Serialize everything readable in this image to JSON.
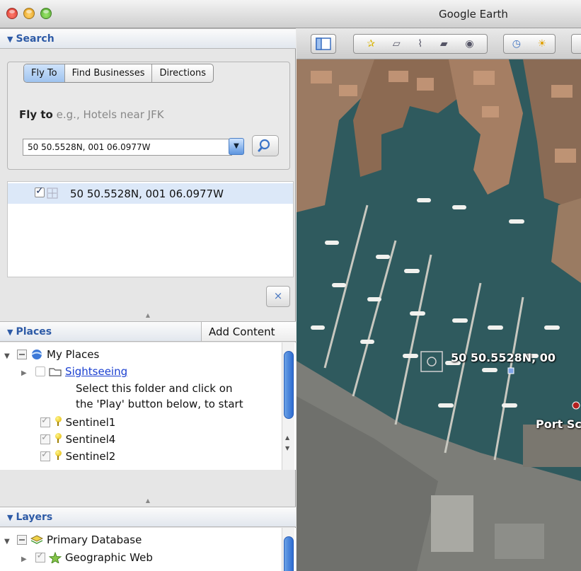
{
  "window": {
    "title": "Google Earth"
  },
  "search": {
    "header": "Search",
    "tabs": [
      {
        "label": "Fly To",
        "active": true
      },
      {
        "label": "Find Businesses",
        "active": false
      },
      {
        "label": "Directions",
        "active": false
      }
    ],
    "fly_to_label": "Fly to",
    "fly_to_hint": "e.g., Hotels near JFK",
    "input_value": "50 50.5528N, 001 06.0977W",
    "result": "50 50.5528N, 001 06.0977W",
    "clear_label": "×"
  },
  "places": {
    "header": "Places",
    "add_content": "Add Content",
    "items": {
      "my_places": "My Places",
      "sightseeing": "Sightseeing",
      "sightseeing_desc_1": "Select this folder and click on",
      "sightseeing_desc_2": "the 'Play' button below, to start",
      "sentinel1": "Sentinel1",
      "sentinel4": "Sentinel4",
      "sentinel2": "Sentinel2"
    }
  },
  "layers": {
    "header": "Layers",
    "items": {
      "primary_db": "Primary Database",
      "geographic_web": "Geographic Web"
    }
  },
  "map": {
    "placemark_label": "50 50.5528N, 00",
    "port_label": "Port Sc"
  },
  "colors": {
    "accent": "#2d5aa6",
    "selection": "#dce8f8",
    "water": "#2f5a5e"
  }
}
